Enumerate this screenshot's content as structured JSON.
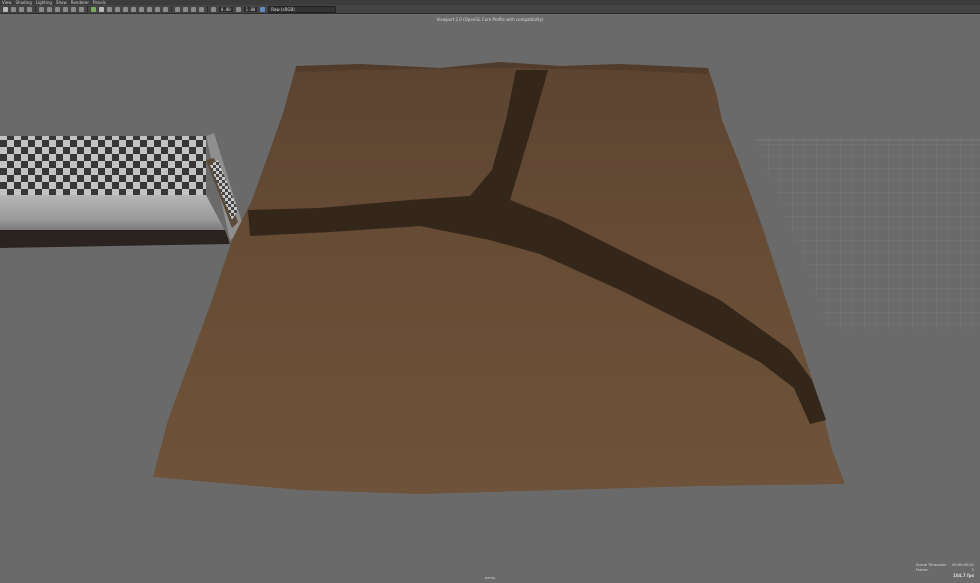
{
  "menubar": {
    "items": [
      "View",
      "Shading",
      "Lighting",
      "Show",
      "Renderer",
      "Panels"
    ]
  },
  "toolbar": {
    "exposure": "0.00",
    "gamma": "1.00",
    "colorspace": "Raw (sRGB)"
  },
  "viewport": {
    "title": "Viewport 2.0 (OpenGL Core Profile with compatibility)",
    "camera": "persp"
  },
  "hud": {
    "timecode_label": "Scene Timecode:",
    "timecode_value": "00:00:00:01",
    "frame_label": "Frame:",
    "frame_value": "1",
    "memory": "104.7 fps"
  },
  "colors": {
    "background": "#6a6a6a",
    "terrain": "#6b5038",
    "road": "#3e2e1e",
    "grid": "#8a8a8a"
  }
}
